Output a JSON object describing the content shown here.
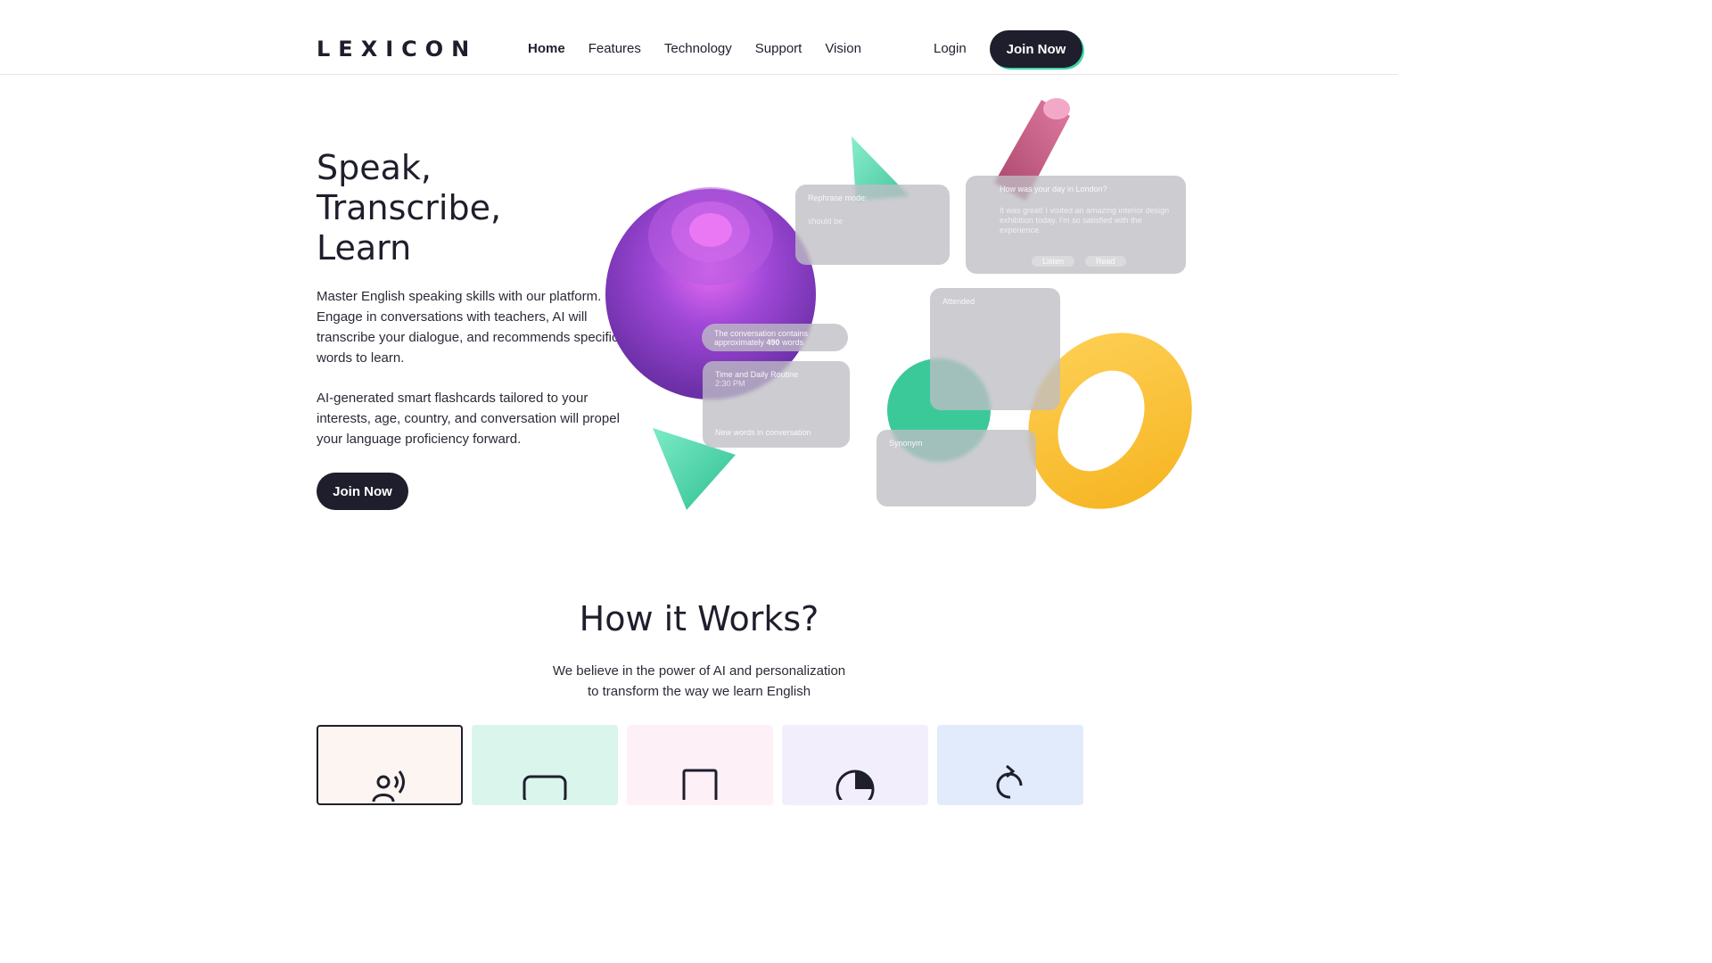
{
  "header": {
    "logo": "LEXICON",
    "nav": [
      {
        "label": "Home",
        "active": true
      },
      {
        "label": "Features"
      },
      {
        "label": "Technology"
      },
      {
        "label": "Support"
      },
      {
        "label": "Vision"
      }
    ],
    "login_label": "Login",
    "join_label": "Join Now"
  },
  "hero": {
    "title_lines": [
      "Speak,",
      "Transcribe,",
      "Learn"
    ],
    "paragraph1": "Master English speaking skills with our platform. Engage in conversations with teachers, AI will transcribe your dialogue, and recommends specific words to learn.",
    "paragraph2": "AI-generated smart flashcards tailored to your interests, age, country, and conversation will propel your language proficiency forward.",
    "join_label": "Join Now"
  },
  "illustration": {
    "cards": {
      "rephrase_title": "Rephrase mode:",
      "rephrase_should_be": "should be",
      "chat_question": "How was your day in London?",
      "chat_answer": "It was great! I visited an amazing interior design exhibition today. I'm so satisfied with the experience.",
      "chat_btn1": "Listen",
      "chat_btn2": "Read",
      "attended_title": "Attended",
      "convo_text": "The conversation contains approximately",
      "convo_count": "490",
      "convo_unit": "words",
      "routine_title": "Time and Daily Routine",
      "routine_time": "2:30 PM",
      "routine_footer": "New words in conversation",
      "synonym_title": "Synonym"
    },
    "colors": {
      "sphere": "#9b3fd6",
      "cone": "#3cd6a3",
      "cylinder": "#c7527e",
      "ring": "#ffc22e"
    }
  },
  "how": {
    "title": "How it Works?",
    "subtitle_lines": [
      "We believe in the power of AI and personalization",
      "to transform the way we learn English"
    ],
    "steps": [
      {
        "icon": "speaking-person-icon",
        "color": "#fdf5f1",
        "selected": true
      },
      {
        "icon": "image-card-icon",
        "color": "#daf5ec"
      },
      {
        "icon": "square-doc-icon",
        "color": "#fdf0f6"
      },
      {
        "icon": "pie-chart-icon",
        "color": "#f3eefb"
      },
      {
        "icon": "refresh-icon",
        "color": "#e2ebfb"
      }
    ]
  }
}
